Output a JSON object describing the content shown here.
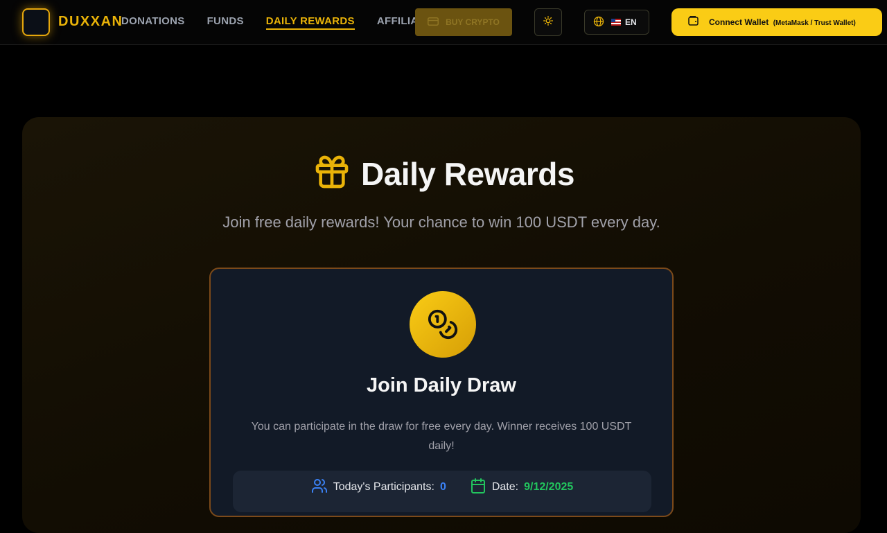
{
  "header": {
    "brand": "DUXXAN",
    "nav": [
      {
        "label": "DONATIONS",
        "active": false
      },
      {
        "label": "FUNDS",
        "active": false
      },
      {
        "label": "DAILY REWARDS",
        "active": true
      },
      {
        "label": "AFFILIATE",
        "active": false
      }
    ],
    "buy_crypto": "BUY CRYPTO",
    "language": "EN",
    "connect_wallet": "Connect Wallet",
    "wallet_hint": "(MetaMask / Trust Wallet)"
  },
  "hero": {
    "title": "Daily Rewards",
    "subtitle": "Join free daily rewards! Your chance to win 100 USDT every day."
  },
  "card": {
    "title": "Join Daily Draw",
    "description": "You can participate in the draw for free every day. Winner receives 100 USDT daily!",
    "participants_label": "Today's Participants:",
    "participants_value": "0",
    "date_label": "Date:",
    "date_value": "9/12/2025"
  },
  "colors": {
    "accent": "#eab308",
    "participants": "#3b82f6",
    "date": "#22c55e"
  },
  "icons": [
    "logo-icon",
    "credit-card-icon",
    "sun-icon",
    "globe-icon",
    "wallet-icon",
    "gift-icon",
    "coins-icon",
    "users-icon",
    "calendar-icon"
  ]
}
